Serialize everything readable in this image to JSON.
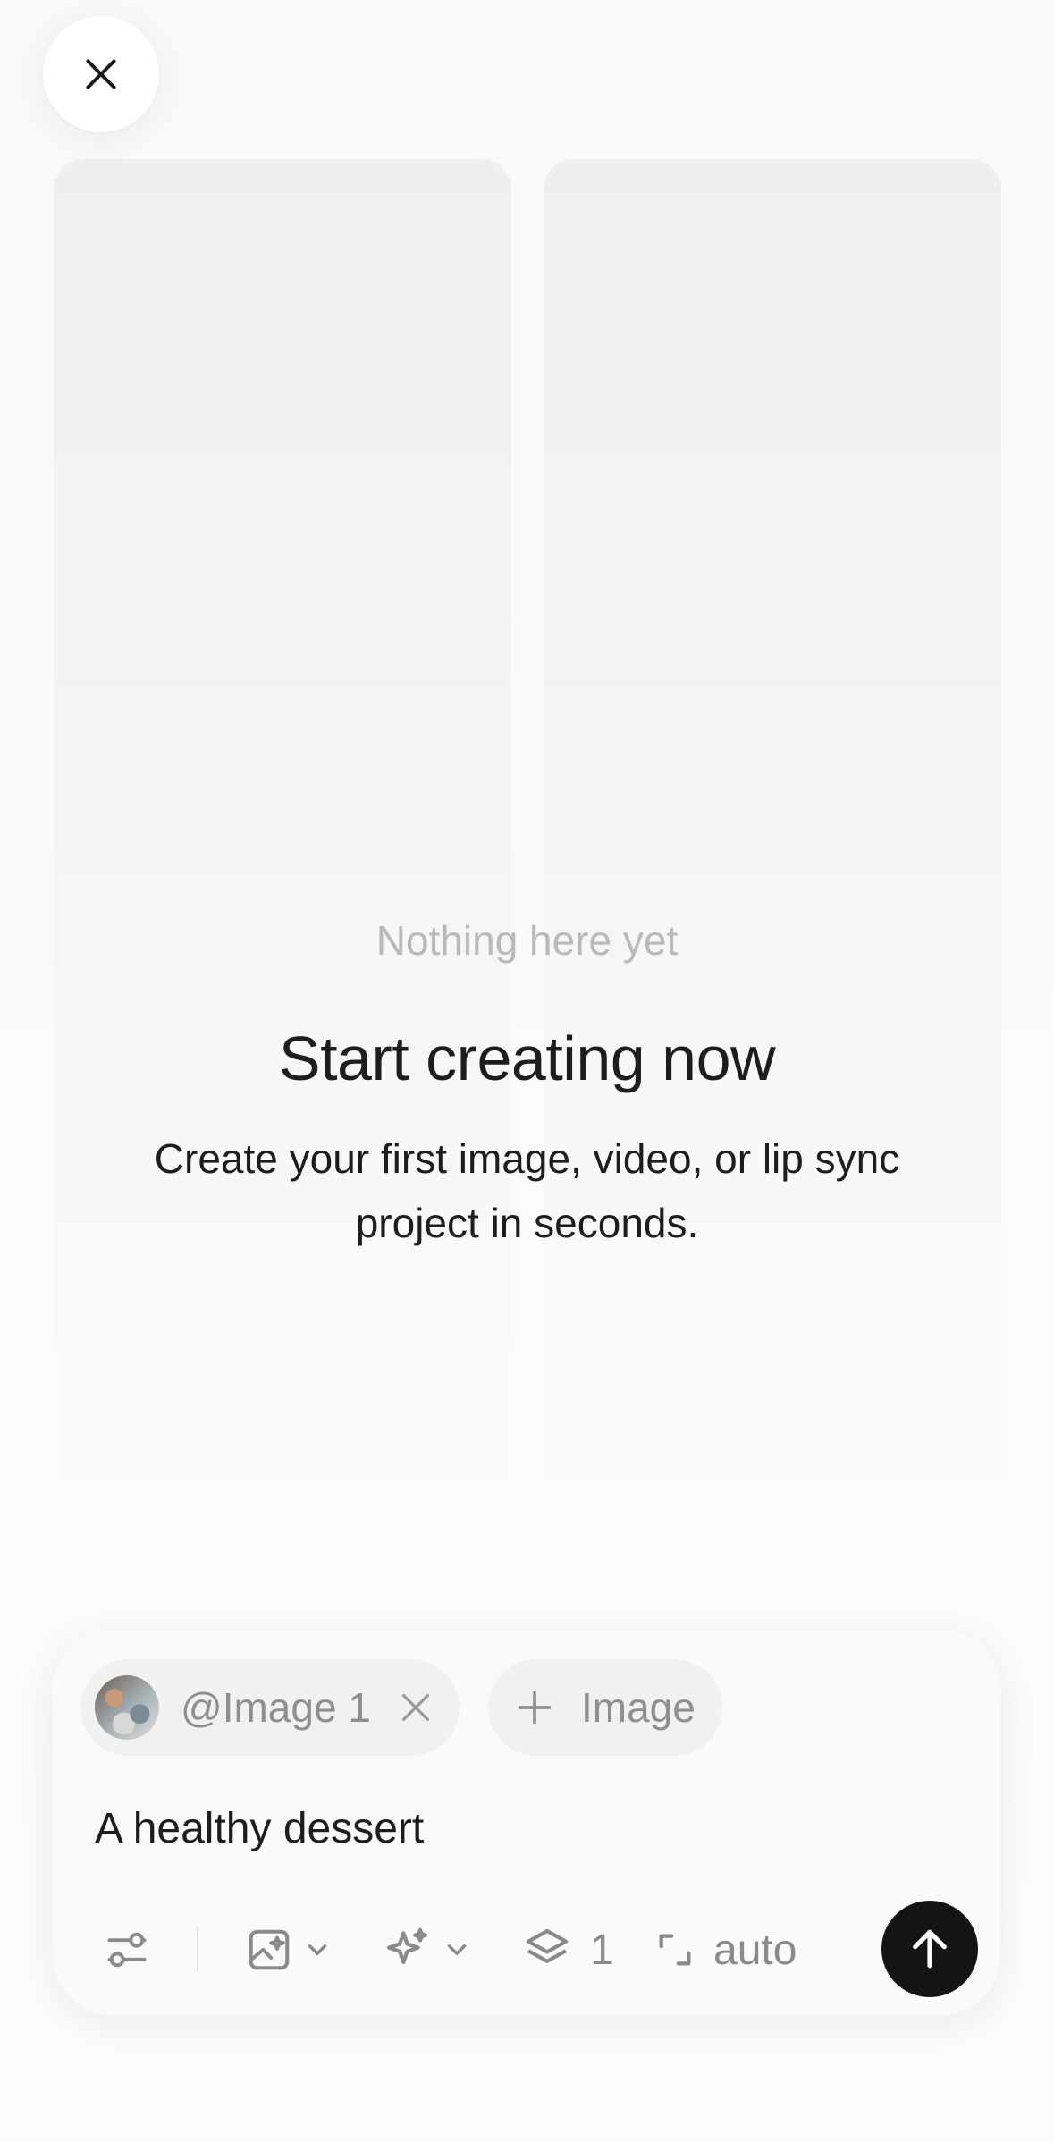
{
  "header": {
    "close_icon": "close-icon"
  },
  "empty_state": {
    "eyebrow": "Nothing here yet",
    "title": "Start creating now",
    "description": "Create your first image, video, or lip sync project in seconds."
  },
  "composer": {
    "attachment_chip": {
      "label": "@Image 1",
      "remove_icon": "close-icon"
    },
    "add_image_label": "Image",
    "prompt_value": "A healthy dessert",
    "toolbar": {
      "settings_icon": "sliders-icon",
      "mode_icon": "image-sparkle-icon",
      "model_icon": "sparkle-icon",
      "count_icon": "layers-icon",
      "count_value": "1",
      "aspect_icon": "aspect-ratio-icon",
      "aspect_value": "auto",
      "send_icon": "arrow-up-icon"
    }
  },
  "colors": {
    "send_button": "#141414",
    "muted_text": "#8f8f8f",
    "eyebrow_text": "#b9b9b9"
  }
}
